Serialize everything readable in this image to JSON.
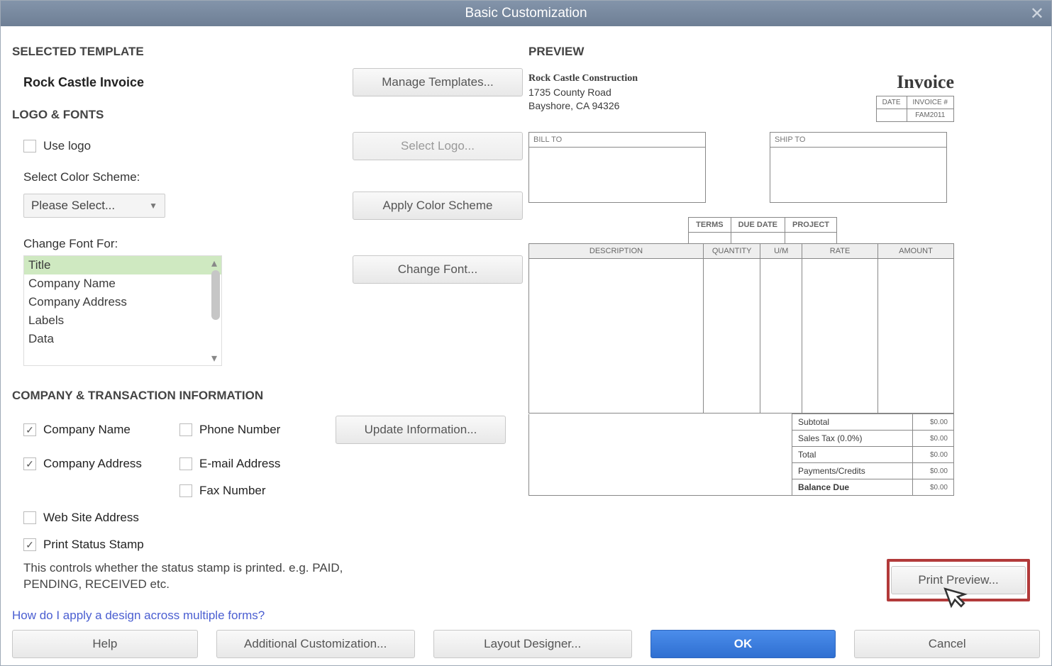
{
  "titlebar": {
    "title": "Basic Customization"
  },
  "left": {
    "selected_template_header": "SELECTED TEMPLATE",
    "template_name": "Rock Castle Invoice",
    "manage_templates_btn": "Manage Templates...",
    "logo_fonts_header": "LOGO & FONTS",
    "use_logo_label": "Use logo",
    "select_logo_btn": "Select Logo...",
    "color_scheme_label": "Select Color Scheme:",
    "color_scheme_value": "Please Select...",
    "apply_color_btn": "Apply Color Scheme",
    "font_for_label": "Change Font For:",
    "font_items": [
      "Title",
      "Company Name",
      "Company Address",
      "Labels",
      "Data"
    ],
    "change_font_btn": "Change Font...",
    "company_header": "COMPANY & TRANSACTION INFORMATION",
    "ci": {
      "company_name": "Company Name",
      "phone": "Phone Number",
      "update_btn": "Update Information...",
      "company_address": "Company Address",
      "email": "E-mail Address",
      "fax": "Fax Number",
      "website": "Web Site Address",
      "print_stamp": "Print Status Stamp"
    },
    "stamp_hint": "This controls whether the status stamp is printed. e.g. PAID, PENDING, RECEIVED etc.",
    "help_link": "How do I apply a design across multiple forms?"
  },
  "preview": {
    "header": "PREVIEW",
    "company_name": "Rock Castle Construction",
    "addr1": "1735 County Road",
    "addr2": "Bayshore, CA 94326",
    "invoice_title": "Invoice",
    "date_lbl": "DATE",
    "invno_lbl": "INVOICE #",
    "invno_val": "FAM2011",
    "billto_lbl": "BILL TO",
    "shipto_lbl": "SHIP TO",
    "terms_lbl": "TERMS",
    "duedate_lbl": "DUE DATE",
    "project_lbl": "PROJECT",
    "cols": {
      "desc": "DESCRIPTION",
      "qty": "QUANTITY",
      "um": "U/M",
      "rate": "RATE",
      "amount": "AMOUNT"
    },
    "totals": {
      "subtotal_lbl": "Subtotal",
      "subtotal_val": "$0.00",
      "tax_lbl": "Sales Tax (0.0%)",
      "tax_val": "$0.00",
      "total_lbl": "Total",
      "total_val": "$0.00",
      "paycred_lbl": "Payments/Credits",
      "paycred_val": "$0.00",
      "balance_lbl": "Balance Due",
      "balance_val": "$0.00"
    },
    "print_preview_btn": "Print Preview..."
  },
  "footer": {
    "help": "Help",
    "additional": "Additional Customization...",
    "layout": "Layout Designer...",
    "ok": "OK",
    "cancel": "Cancel"
  }
}
